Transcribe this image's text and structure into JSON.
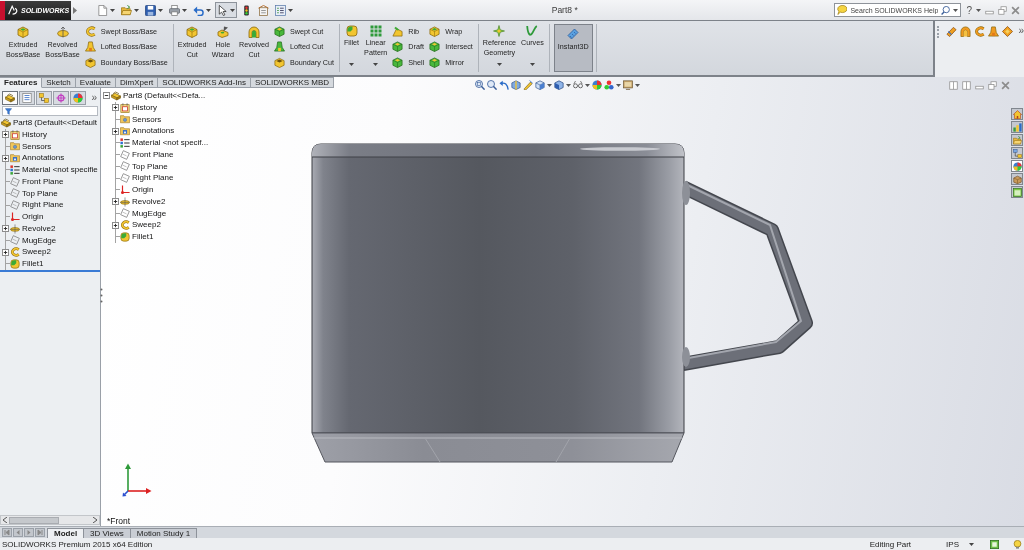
{
  "title_bar": {
    "app_name": "SOLIDWORKS",
    "quick_access": [
      {
        "kind": "new",
        "dropdown": true,
        "selected": false
      },
      {
        "kind": "open",
        "dropdown": true,
        "selected": false
      },
      {
        "kind": "save",
        "dropdown": true,
        "selected": false
      },
      {
        "kind": "print",
        "dropdown": true,
        "selected": false
      },
      {
        "kind": "undo",
        "dropdown": true,
        "selected": false
      },
      {
        "kind": "select",
        "dropdown": true,
        "selected": true
      },
      {
        "kind": "rebuild",
        "dropdown": false,
        "selected": false
      },
      {
        "kind": "properties",
        "dropdown": false,
        "selected": false
      },
      {
        "kind": "options",
        "dropdown": true,
        "selected": false
      }
    ],
    "document_title": "Part8 *",
    "search": {
      "placeholder": "Search SOLIDWORKS Help"
    },
    "help": "?"
  },
  "ribbon": {
    "groups": [
      {
        "items": [
          {
            "kind": "large",
            "label": "Extruded\nBoss/Base",
            "dropdown": false,
            "on": false
          },
          {
            "kind": "large",
            "label": "Revolved\nBoss/Base",
            "dropdown": false,
            "on": false
          },
          {
            "kind": "stack",
            "entries": [
              "Swept Boss/Base",
              "Lofted Boss/Base",
              "Boundary Boss/Base"
            ]
          }
        ]
      },
      {
        "items": [
          {
            "kind": "large",
            "label": "Extruded\nCut",
            "dropdown": false,
            "on": false
          },
          {
            "kind": "large",
            "label": "Hole\nWizard",
            "dropdown": false,
            "on": false
          },
          {
            "kind": "large",
            "label": "Revolved\nCut",
            "dropdown": false,
            "on": false
          },
          {
            "kind": "stack",
            "entries": [
              "Swept Cut",
              "Lofted Cut",
              "Boundary Cut"
            ]
          }
        ]
      },
      {
        "items": [
          {
            "kind": "large",
            "label": "Fillet",
            "dropdown": true,
            "on": false
          },
          {
            "kind": "large",
            "label": "Linear\nPattern",
            "dropdown": true,
            "on": false
          },
          {
            "kind": "stack",
            "entries": [
              "Rib",
              "Draft",
              "Shell"
            ]
          },
          {
            "kind": "stack",
            "entries": [
              "Wrap",
              "Intersect",
              "Mirror"
            ]
          }
        ]
      },
      {
        "items": [
          {
            "kind": "large",
            "label": "Reference\nGeometry",
            "dropdown": true,
            "on": false
          },
          {
            "kind": "large",
            "label": "Curves",
            "dropdown": true,
            "on": false
          }
        ]
      },
      {
        "items": [
          {
            "kind": "large",
            "label": "Instant3D",
            "dropdown": false,
            "on": true
          }
        ]
      }
    ],
    "more": "»"
  },
  "command_tabs": [
    {
      "label": "Features",
      "selected": true
    },
    {
      "label": "Sketch",
      "selected": false
    },
    {
      "label": "Evaluate",
      "selected": false
    },
    {
      "label": "DimXpert",
      "selected": false
    },
    {
      "label": "SOLIDWORKS Add-Ins",
      "selected": false
    },
    {
      "label": "SOLIDWORKS MBD",
      "selected": false
    }
  ],
  "feature_manager": {
    "panel_tabs": [
      {
        "selected": true
      },
      {
        "selected": false
      },
      {
        "selected": false
      },
      {
        "selected": false
      },
      {
        "selected": false
      }
    ],
    "more": "»",
    "tree": {
      "root": {
        "label": "Part8 (Default<<Default"
      },
      "items": [
        {
          "label": "History",
          "kind": "history",
          "expandable": true
        },
        {
          "label": "Sensors",
          "kind": "sensors",
          "expandable": false
        },
        {
          "label": "Annotations",
          "kind": "annotations",
          "expandable": true
        },
        {
          "label": "Material <not specifie",
          "kind": "material",
          "expandable": false
        },
        {
          "label": "Front Plane",
          "kind": "plane",
          "expandable": false
        },
        {
          "label": "Top Plane",
          "kind": "plane",
          "expandable": false
        },
        {
          "label": "Right Plane",
          "kind": "plane",
          "expandable": false
        },
        {
          "label": "Origin",
          "kind": "origin",
          "expandable": false
        },
        {
          "label": "Revolve2",
          "kind": "revolve",
          "expandable": true
        },
        {
          "label": "MugEdge",
          "kind": "plane",
          "expandable": false
        },
        {
          "label": "Sweep2",
          "kind": "sweep",
          "expandable": true
        },
        {
          "label": "Fillet1",
          "kind": "fillet",
          "expandable": false
        }
      ]
    }
  },
  "viewport": {
    "view_toolbar": [
      {
        "kind": "zoomfit",
        "dropdown": false
      },
      {
        "kind": "zoomarea",
        "dropdown": false
      },
      {
        "kind": "previous",
        "dropdown": false
      },
      {
        "kind": "section",
        "dropdown": false
      },
      {
        "kind": "annotation",
        "dropdown": false
      },
      {
        "kind": "orientation",
        "dropdown": true
      },
      {
        "kind": "display",
        "dropdown": true
      },
      {
        "kind": "hideshow",
        "dropdown": true
      },
      {
        "kind": "appearance",
        "dropdown": false
      },
      {
        "kind": "scene",
        "dropdown": true
      },
      {
        "kind": "settings",
        "dropdown": true
      }
    ],
    "flyout_tree": {
      "root": {
        "label": "Part8 (Default<<Defa...",
        "expanded": true
      },
      "items": [
        {
          "label": "History",
          "kind": "history",
          "expandable": true
        },
        {
          "label": "Sensors",
          "kind": "sensors",
          "expandable": false
        },
        {
          "label": "Annotations",
          "kind": "annotations",
          "expandable": true
        },
        {
          "label": "Material <not specif...",
          "kind": "material",
          "expandable": false
        },
        {
          "label": "Front Plane",
          "kind": "plane",
          "expandable": false
        },
        {
          "label": "Top Plane",
          "kind": "plane",
          "expandable": false
        },
        {
          "label": "Right Plane",
          "kind": "plane",
          "expandable": false
        },
        {
          "label": "Origin",
          "kind": "origin",
          "expandable": false
        },
        {
          "label": "Revolve2",
          "kind": "revolve",
          "expandable": true
        },
        {
          "label": "MugEdge",
          "kind": "plane",
          "expandable": false
        },
        {
          "label": "Sweep2",
          "kind": "sweep",
          "expandable": true
        },
        {
          "label": "Fillet1",
          "kind": "fillet",
          "expandable": false
        }
      ]
    },
    "task_pane": [
      {
        "kind": "home",
        "selected": false
      },
      {
        "kind": "resources",
        "selected": false
      },
      {
        "kind": "library",
        "selected": false
      },
      {
        "kind": "explorer",
        "selected": false
      },
      {
        "kind": "appearances",
        "selected": true
      },
      {
        "kind": "palette",
        "selected": false
      },
      {
        "kind": "properties",
        "selected": false
      }
    ],
    "view_label": "*Front"
  },
  "document_tabs": [
    {
      "label": "Model",
      "selected": true
    },
    {
      "label": "3D Views",
      "selected": false
    },
    {
      "label": "Motion Study 1",
      "selected": false
    }
  ],
  "status_bar": {
    "edition": "SOLIDWORKS Premium 2015 x64 Edition",
    "mode": "Editing Part",
    "units": "IPS"
  }
}
